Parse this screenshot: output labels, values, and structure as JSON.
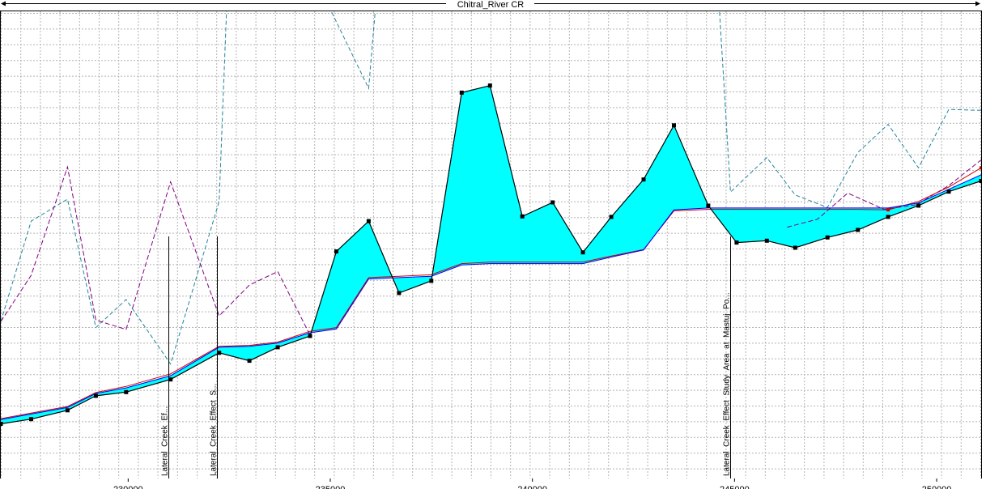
{
  "chart_data": {
    "type": "line",
    "title": "Chitral_River CR",
    "xlabel": "",
    "ylabel": "",
    "xlim": [
      226850,
      251100
    ],
    "ylim": [
      0,
      100
    ],
    "grid": true,
    "x_ticks": [
      230000,
      235000,
      240000,
      245000,
      250000
    ],
    "x_tick_labels": [
      "230000",
      "235000",
      "240000",
      "245000",
      "250000"
    ],
    "lateral_structures": [
      {
        "name": "Lateral_Creek_Ef...",
        "x": 231000
      },
      {
        "name": "Lateral_Creek_Effect_S...",
        "x": 232200
      },
      {
        "name": "Lateral_Creek_Effect_Study_Area_at_Mastuj_Po...",
        "x": 244900
      }
    ],
    "series": [
      {
        "key": "ground",
        "style": "ground",
        "color": "#000000",
        "x": [
          226850,
          227600,
          228500,
          229200,
          229950,
          231050,
          232250,
          233000,
          233700,
          234500,
          235150,
          235950,
          236700,
          237500,
          238250,
          238950,
          239750,
          240500,
          241250,
          241950,
          242750,
          243500,
          244350,
          245050,
          245800,
          246500,
          247300,
          248050,
          248800,
          249550,
          250300,
          251100
        ],
        "y": [
          11.7,
          12.7,
          14.6,
          17.7,
          18.5,
          21.2,
          26.9,
          25.2,
          28.1,
          30.5,
          48.6,
          55.1,
          39.7,
          42.3,
          82.6,
          84.1,
          56.1,
          59.1,
          48.4,
          56.0,
          64.0,
          75.6,
          58.4,
          50.5,
          50.9,
          49.4,
          51.6,
          53.2,
          56.0,
          58.4,
          61.4,
          63.7
        ]
      },
      {
        "key": "water",
        "style": "water",
        "color": "#00ffff",
        "x": [
          226850,
          227600,
          228500,
          229200,
          229950,
          231050,
          232250,
          233000,
          233700,
          234500,
          235150,
          235950,
          236700,
          237500,
          238250,
          238950,
          239750,
          240500,
          241250,
          241950,
          242750,
          243500,
          244350,
          245050,
          245800,
          246500,
          247300,
          248050,
          248800,
          249550,
          250300,
          251100
        ],
        "y": [
          12.6,
          13.8,
          15.2,
          18.2,
          19.4,
          22.0,
          28.1,
          28.3,
          29.0,
          31.2,
          32.0,
          42.7,
          43.0,
          43.3,
          45.7,
          46.0,
          46.0,
          46.0,
          46.0,
          47.4,
          48.9,
          57.5,
          57.9,
          57.9,
          57.9,
          57.9,
          57.9,
          57.9,
          57.9,
          59.0,
          61.9,
          65.0
        ]
      },
      {
        "key": "red",
        "style": "thin",
        "color": "#cc0000",
        "x": [
          226850,
          227600,
          228500,
          229200,
          229950,
          231050,
          232250,
          233000,
          233700,
          234500,
          235150,
          235950,
          236700,
          237500,
          238250,
          238950,
          239750,
          240500,
          241250,
          241950,
          242750,
          243500,
          244350,
          245050,
          245800,
          246500,
          247300,
          248050,
          248800,
          249550,
          250300,
          251100
        ],
        "y": [
          12.8,
          14.0,
          15.4,
          18.4,
          19.7,
          22.4,
          28.3,
          28.5,
          29.2,
          31.5,
          32.3,
          43.0,
          43.3,
          43.6,
          46.0,
          46.3,
          46.3,
          46.3,
          46.3,
          47.6,
          49.0,
          57.3,
          57.6,
          57.6,
          57.6,
          57.6,
          57.6,
          57.6,
          57.5,
          59.3,
          62.4,
          66.5
        ]
      },
      {
        "key": "purple",
        "style": "dash",
        "color": "#800080",
        "x": [
          226850,
          227600,
          228500,
          229200,
          229950,
          231050,
          232250,
          233000,
          233700,
          234500
        ],
        "y": [
          33.6,
          43.5,
          66.7,
          33.9,
          31.9,
          63.5,
          34.8,
          41.4,
          44.3,
          30.7
        ]
      },
      {
        "key": "purple2",
        "style": "dash",
        "color": "#800080",
        "x": [
          246300,
          247050,
          247800,
          248700,
          249500,
          250300,
          251100
        ],
        "y": [
          53.8,
          55.5,
          61.1,
          57.6,
          58.6,
          62.7,
          68.2
        ]
      },
      {
        "key": "teal",
        "style": "dash",
        "color": "#20859a",
        "x": [
          226850,
          227600,
          228500,
          229200,
          229950,
          231050,
          232250,
          232450,
          234800,
          235950,
          236150,
          236700
        ],
        "y": [
          33.6,
          55.1,
          59.8,
          32.3,
          38.3,
          24.5,
          59.3,
          104,
          104,
          83.5,
          104,
          104
        ]
      },
      {
        "key": "teal2",
        "style": "dash",
        "color": "#20859a",
        "x": [
          244600,
          244900,
          245800,
          246500,
          247300,
          248050,
          248800,
          249550,
          250300,
          251100
        ],
        "y": [
          104,
          61.3,
          68.7,
          60.7,
          58.0,
          69.8,
          75.8,
          66.5,
          79.0,
          78.8
        ]
      }
    ]
  }
}
